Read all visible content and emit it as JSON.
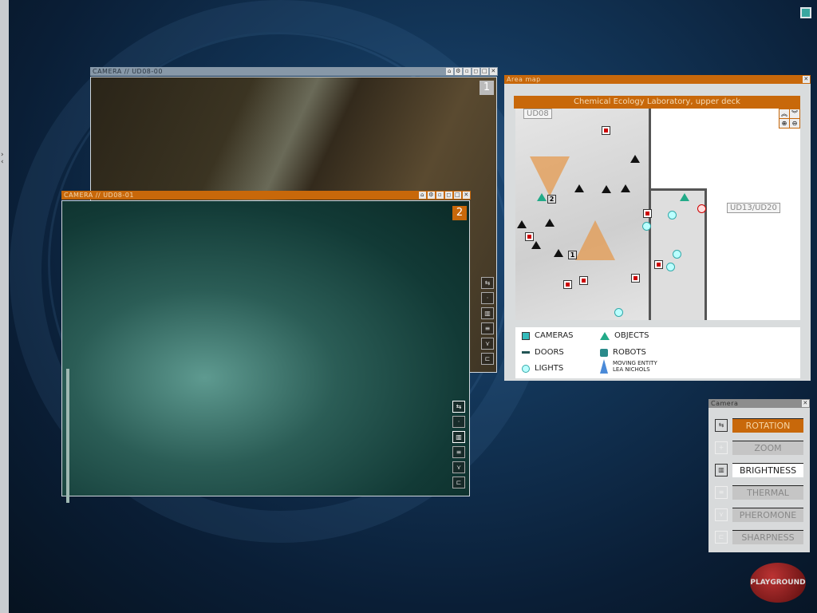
{
  "camera_windows": [
    {
      "title": "CAMERA // UD08-00",
      "number": "1",
      "controls": [
        "lock",
        "gear",
        "small",
        "medium",
        "max",
        "close"
      ]
    },
    {
      "title": "CAMERA // UD08-01",
      "number": "2",
      "controls": [
        "lock",
        "gear",
        "small",
        "medium",
        "max",
        "close"
      ]
    }
  ],
  "area_map": {
    "title": "Area map",
    "header": "Chemical Ecology Laboratory, upper deck",
    "zone_label": "UD08",
    "exit_label": "UD13/UD20",
    "camera_markers": [
      "1",
      "2"
    ],
    "controls": [
      "scroll-up",
      "scroll-down",
      "zoom-in",
      "zoom-out"
    ],
    "legend": {
      "cameras": "CAMERAS",
      "doors": "DOORS",
      "lights": "LIGHTS",
      "objects": "OBJECTS",
      "robots": "ROBOTS",
      "moving_entity": "MOVING ENTITY",
      "moving_entity_name": "LEA NICHOLS"
    }
  },
  "camera_panel": {
    "title": "Camera",
    "buttons": [
      {
        "label": "ROTATION",
        "state": "active"
      },
      {
        "label": "ZOOM",
        "state": "disabled"
      },
      {
        "label": "BRIGHTNESS",
        "state": "selected"
      },
      {
        "label": "THERMAL",
        "state": "disabled"
      },
      {
        "label": "PHEROMONE",
        "state": "disabled"
      },
      {
        "label": "SHARPNESS",
        "state": "disabled"
      }
    ]
  },
  "logo": "PLAYGROUND",
  "colors": {
    "accent": "#c8680a",
    "inactive_title": "#8798a8",
    "light": "#39a7a0",
    "marker": "#cc0000"
  }
}
